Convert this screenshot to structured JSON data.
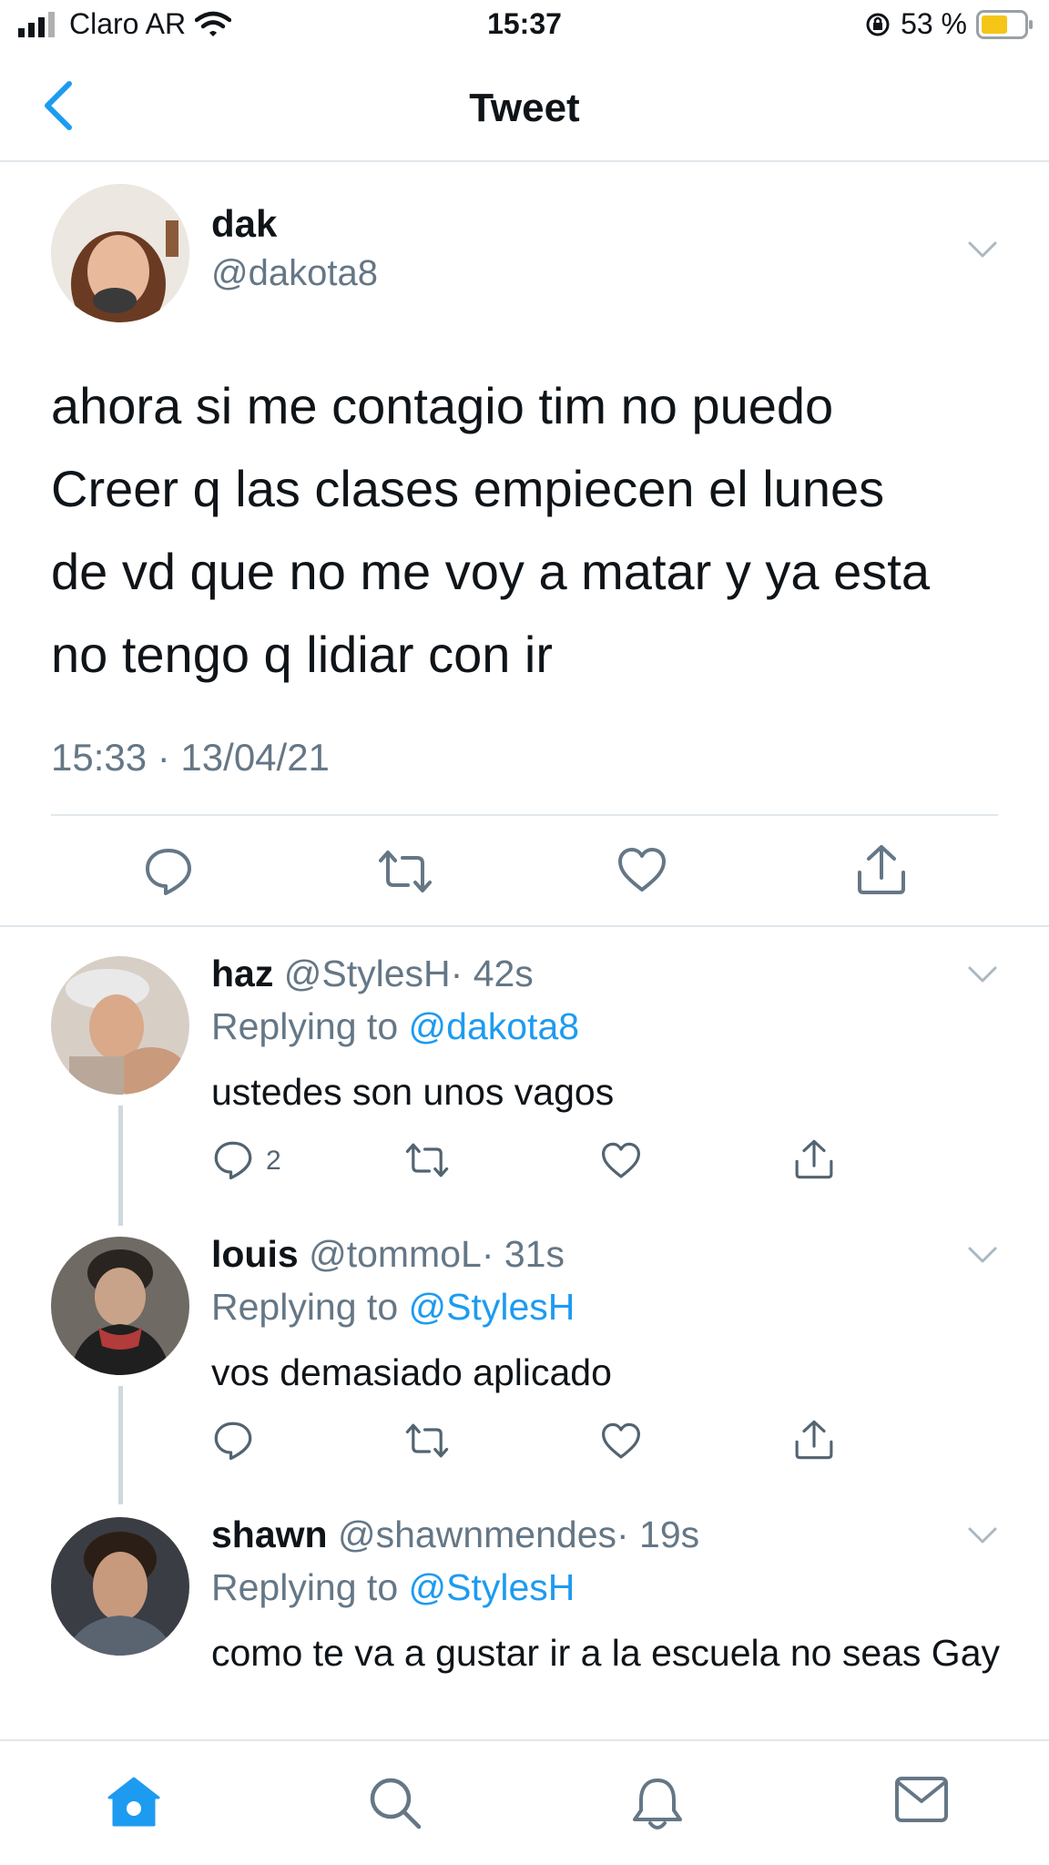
{
  "status_bar": {
    "carrier": "Claro AR",
    "time": "15:37",
    "battery": "53 %"
  },
  "nav": {
    "title": "Tweet"
  },
  "main_tweet": {
    "name": "dak",
    "handle": "@dakota8",
    "text_lines": [
      "ahora si me contagio tim no puedo",
      "Creer q las clases empiecen el lunes",
      "de vd que no me voy a matar y ya esta",
      "no tengo q lidiar con ir"
    ],
    "timestamp": "15:33 · 13/04/21"
  },
  "replies": [
    {
      "name": "haz",
      "handle": "@StylesH",
      "age": "· 42s",
      "replying_label": "Replying to",
      "replying_to": "@dakota8",
      "text": "ustedes son unos vagos",
      "reply_count": "2"
    },
    {
      "name": "louis",
      "handle": "@tommoL",
      "age": "· 31s",
      "replying_label": "Replying to",
      "replying_to": "@StylesH",
      "text": "vos demasiado aplicado",
      "reply_count": ""
    },
    {
      "name": "shawn",
      "handle": "@shawnmendes",
      "age": "· 19s",
      "replying_label": "Replying to",
      "replying_to": "@StylesH",
      "text": "como te va a gustar ir a la escuela no seas Gay",
      "reply_count": ""
    }
  ],
  "tabs": [
    "home-icon",
    "search-icon",
    "bell-icon",
    "mail-icon"
  ],
  "colors": {
    "accent": "#1d9bf0",
    "muted": "#657786",
    "divider": "#e1e8ed",
    "battery": "#f5c518"
  }
}
